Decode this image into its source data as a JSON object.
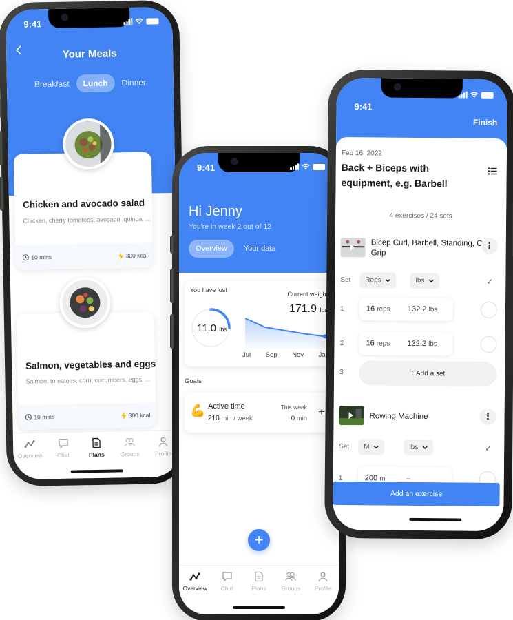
{
  "status": {
    "time": "9:41"
  },
  "colors": {
    "accent": "#4284f3",
    "bolt": "#f5b900",
    "text": "#1c1c1e"
  },
  "meals_screen": {
    "back_icon": "chevron-left-icon",
    "title": "Your Meals",
    "segments": [
      {
        "label": "Breakfast",
        "selected": false
      },
      {
        "label": "Lunch",
        "selected": true
      },
      {
        "label": "Dinner",
        "selected": false
      }
    ],
    "meals": [
      {
        "name": "Chicken and avocado salad",
        "ingredients": "Chicken, cherry tomatoes, avocado, quinoa, ...",
        "time": "10 mins",
        "calories": "300 kcal"
      },
      {
        "name": "Salmon, vegetables and eggs",
        "ingredients": "Salmon, tomatoes, corn, cucumbers, eggs, ...",
        "time": "10 mins",
        "calories": "300 kcal"
      }
    ],
    "tabbar": [
      {
        "label": "Overview",
        "icon": "overview-icon",
        "active": false
      },
      {
        "label": "Chat",
        "icon": "chat-icon",
        "active": false
      },
      {
        "label": "Plans",
        "icon": "plans-icon",
        "active": true
      },
      {
        "label": "Groups",
        "icon": "groups-icon",
        "active": false
      },
      {
        "label": "Profile",
        "icon": "profile-icon",
        "active": false
      }
    ]
  },
  "overview_screen": {
    "greeting": "Hi Jenny",
    "subtitle": "You're in week 2 out of 12",
    "tabs": [
      {
        "label": "Overview",
        "selected": true
      },
      {
        "label": "Your data",
        "selected": false
      }
    ],
    "weight_card": {
      "lost_label": "You have lost",
      "lost_value": "11.0",
      "lost_unit": "lbs",
      "lost_progress": 0.25,
      "current_label": "Current weight",
      "current_value": "171.9",
      "current_unit": "lbs",
      "chart": {
        "x_labels": [
          "Jul",
          "Sep",
          "Nov",
          "Jan"
        ],
        "values": [
          182.9,
          177.5,
          175.5,
          173.5,
          171.9
        ]
      }
    },
    "goals_label": "Goals",
    "goal": {
      "icon": "flexed-biceps-icon",
      "emoji": "💪",
      "name": "Active time",
      "target_value": "210",
      "target_unit": "min / week",
      "week_label": "This week",
      "week_value": "0",
      "week_unit": "min",
      "add_label": "+"
    },
    "fab_label": "+",
    "tabbar": [
      {
        "label": "Overview",
        "icon": "overview-icon",
        "active": true
      },
      {
        "label": "Chat",
        "icon": "chat-icon",
        "active": false
      },
      {
        "label": "Plans",
        "icon": "plans-icon",
        "active": false
      },
      {
        "label": "Groups",
        "icon": "groups-icon",
        "active": false
      },
      {
        "label": "Profile",
        "icon": "profile-icon",
        "active": false
      }
    ]
  },
  "workout_screen": {
    "finish_label": "Finish",
    "date": "Feb 16, 2022",
    "title": "Back + Biceps with equipment, e.g. Barbell",
    "summary": "4 exercises / 24 sets",
    "exercises": [
      {
        "name": "Bicep Curl, Barbell, Standing, Close Grip",
        "set_label": "Set",
        "unit_a": "Reps",
        "unit_b": "lbs",
        "sets": [
          {
            "num": "1",
            "a_val": "16",
            "a_unit": "reps",
            "b_val": "132.2",
            "b_unit": "lbs"
          },
          {
            "num": "2",
            "a_val": "16",
            "a_unit": "reps",
            "b_val": "132.2",
            "b_unit": "lbs"
          }
        ],
        "next_set_num": "3",
        "add_set_label": "+ Add a set"
      },
      {
        "name": "Rowing Machine",
        "set_label": "Set",
        "unit_a": "M",
        "unit_b": "lbs",
        "sets": [
          {
            "num": "1",
            "a_val": "200",
            "a_unit": "m",
            "b_val": "–",
            "b_unit": ""
          }
        ]
      }
    ],
    "add_exercise_label": "Add an exercise"
  }
}
